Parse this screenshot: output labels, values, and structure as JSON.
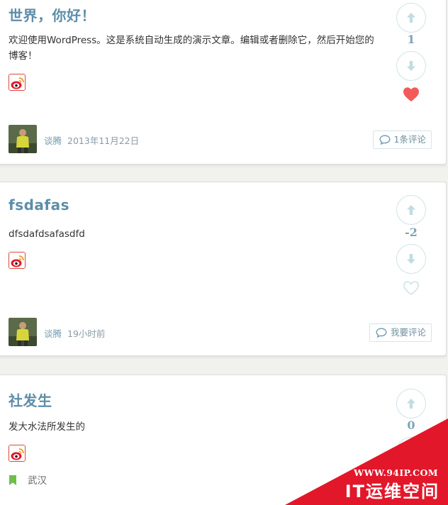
{
  "posts": [
    {
      "title": "世界，你好！",
      "excerpt": "欢迎使用WordPress。这是系统自动生成的演示文章。编辑或者删除它，然后开始您的博客！",
      "votes": "1",
      "liked": true,
      "author": "谈腾",
      "date": "2013年11月22日",
      "comment_label": "1条评论"
    },
    {
      "title": "fsdafas",
      "excerpt": "dfsdafdsafasdfd",
      "votes": "-2",
      "liked": false,
      "author": "谈腾",
      "date": "19小时前",
      "comment_label": "我要评论"
    },
    {
      "title": "社发生",
      "excerpt": "发大水法所发生的",
      "votes": "0",
      "location": "武汉"
    }
  ],
  "icons": {
    "share": "weibo-icon",
    "upvote": "arrow-up-icon",
    "downvote": "arrow-down-icon",
    "like": "heart-icon",
    "comment": "comment-bubble-icon",
    "location": "bookmark-location-icon"
  },
  "colors": {
    "title": "#5d8ea8",
    "heart_active": "#f25a5a",
    "heart_inactive": "#cfe3ea",
    "vote_border": "#cfe3ea",
    "location_icon": "#6cc04a",
    "watermark": "#e3172a"
  },
  "watermark": {
    "url": "WWW.94IP.COM",
    "name": "IT运维空间"
  }
}
